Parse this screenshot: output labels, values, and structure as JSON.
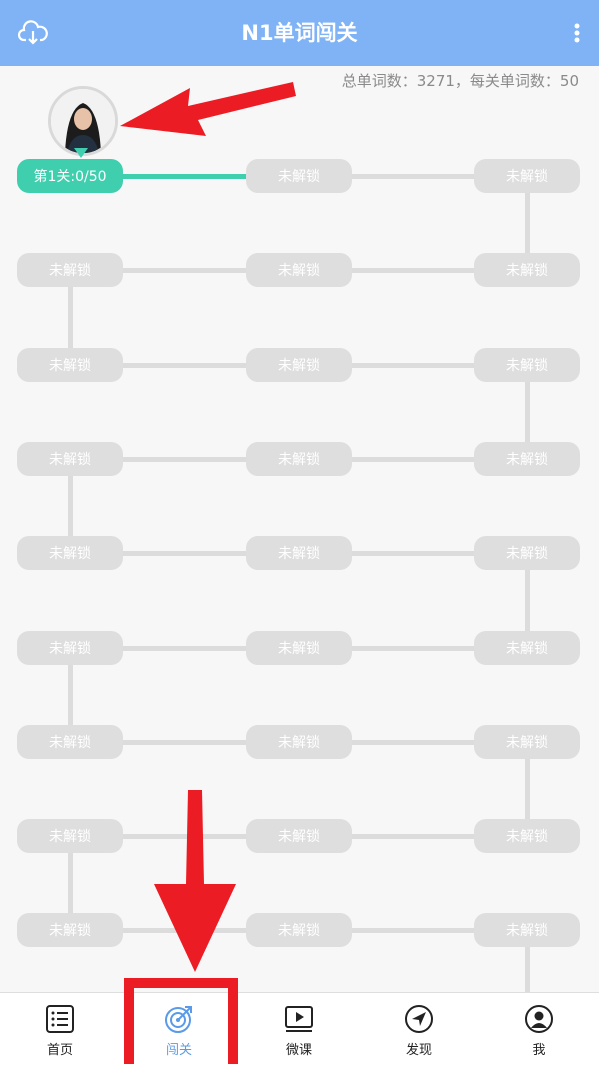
{
  "header": {
    "title": "N1单词闯关",
    "cloud_icon": "cloud-download-icon",
    "more_icon": "more-vertical-icon"
  },
  "stats": {
    "text": "总单词数：3271，每关单词数：50"
  },
  "levels": [
    "第1关:0/50",
    "未解锁",
    "未解锁",
    "未解锁",
    "未解锁",
    "未解锁",
    "未解锁",
    "未解锁",
    "未解锁",
    "未解锁",
    "未解锁",
    "未解锁",
    "未解锁",
    "未解锁",
    "未解锁",
    "未解锁",
    "未解锁",
    "未解锁",
    "未解锁",
    "未解锁",
    "未解锁",
    "未解锁",
    "未解锁",
    "未解锁",
    "未解锁",
    "未解锁",
    "未解锁"
  ],
  "bottom_nav": [
    {
      "label": "首页",
      "icon": "list-icon"
    },
    {
      "label": "闯关",
      "icon": "target-icon"
    },
    {
      "label": "微课",
      "icon": "video-play-icon"
    },
    {
      "label": "发现",
      "icon": "compass-icon"
    },
    {
      "label": "我",
      "icon": "user-icon"
    }
  ],
  "colors": {
    "header": "#7fb3f5",
    "active_level": "#3fcfae",
    "locked_level": "#dedede",
    "annotation": "#ec1c24",
    "nav_active": "#5a9ae8"
  }
}
